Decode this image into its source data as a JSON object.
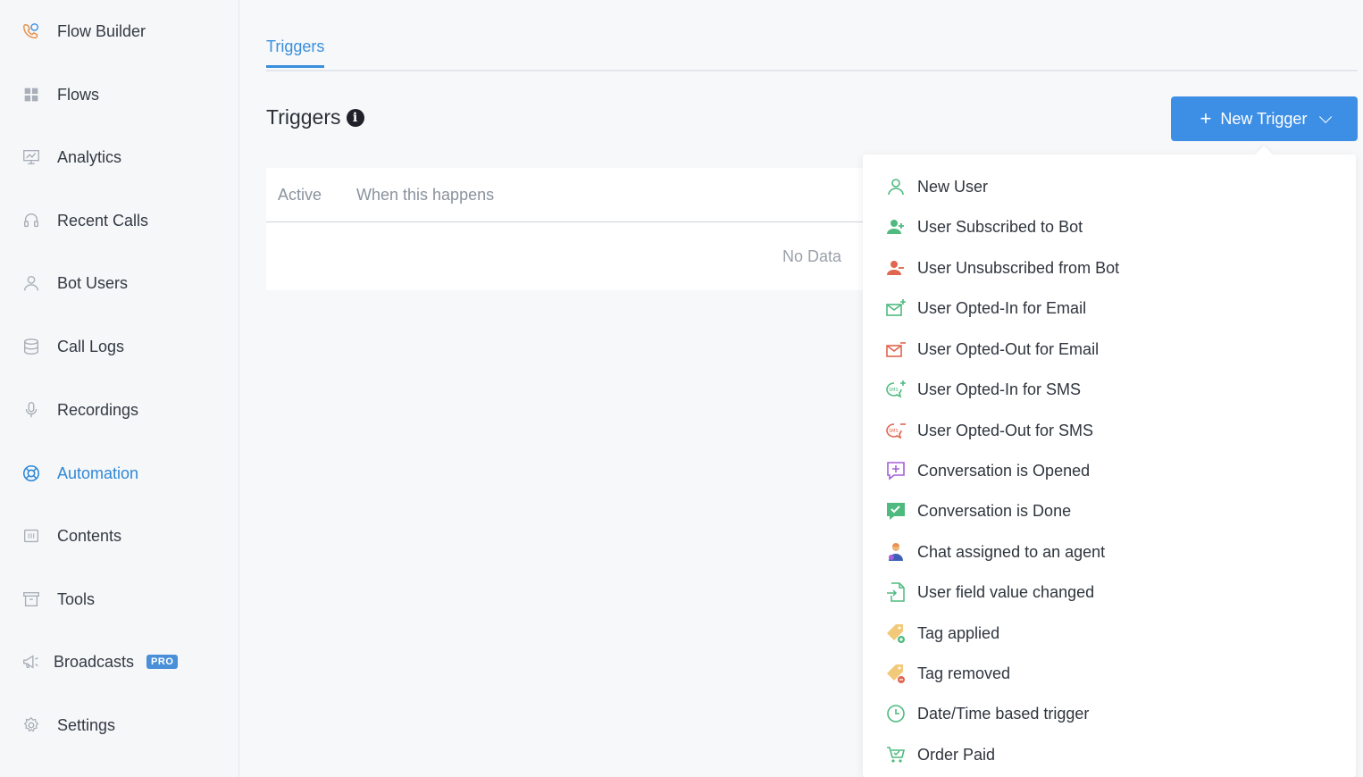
{
  "sidebar": {
    "items": [
      {
        "label": "Flow Builder",
        "icon": "phone-flow-icon"
      },
      {
        "label": "Flows",
        "icon": "grid-icon"
      },
      {
        "label": "Analytics",
        "icon": "presentation-chart-icon"
      },
      {
        "label": "Recent Calls",
        "icon": "headset-icon"
      },
      {
        "label": "Bot Users",
        "icon": "user-icon"
      },
      {
        "label": "Call Logs",
        "icon": "database-icon"
      },
      {
        "label": "Recordings",
        "icon": "microphone-icon"
      },
      {
        "label": "Automation",
        "icon": "lifebuoy-icon",
        "active": true
      },
      {
        "label": "Contents",
        "icon": "content-icon"
      },
      {
        "label": "Tools",
        "icon": "archive-box-icon"
      },
      {
        "label": "Broadcasts",
        "icon": "megaphone-icon",
        "badge": "PRO"
      },
      {
        "label": "Settings",
        "icon": "gear-icon"
      }
    ]
  },
  "tabs": [
    {
      "label": "Triggers",
      "active": true
    }
  ],
  "main": {
    "title": "Triggers",
    "info_glyph": "i",
    "new_trigger_label": "New Trigger",
    "table": {
      "columns": [
        "Active",
        "When this happens"
      ],
      "empty_text": "No Data"
    }
  },
  "dropdown": {
    "items": [
      {
        "label": "New User",
        "icon": "user-outline-icon"
      },
      {
        "label": "User Subscribed to Bot",
        "icon": "user-plus-icon"
      },
      {
        "label": "User Unsubscribed from Bot",
        "icon": "user-minus-icon"
      },
      {
        "label": "User Opted-In for Email",
        "icon": "email-plus-icon"
      },
      {
        "label": "User Opted-Out for Email",
        "icon": "email-minus-icon"
      },
      {
        "label": "User Opted-In for SMS",
        "icon": "sms-plus-icon"
      },
      {
        "label": "User Opted-Out for SMS",
        "icon": "sms-minus-icon"
      },
      {
        "label": "Conversation is Opened",
        "icon": "chat-plus-icon"
      },
      {
        "label": "Conversation is Done",
        "icon": "chat-check-icon"
      },
      {
        "label": "Chat assigned to an agent",
        "icon": "agent-icon"
      },
      {
        "label": "User field value changed",
        "icon": "file-import-icon"
      },
      {
        "label": "Tag applied",
        "icon": "tag-plus-icon"
      },
      {
        "label": "Tag removed",
        "icon": "tag-minus-icon"
      },
      {
        "label": "Date/Time based trigger",
        "icon": "clock-icon"
      },
      {
        "label": "Order Paid",
        "icon": "cart-icon"
      }
    ]
  },
  "colors": {
    "accent": "#3d8fe6",
    "active_nav": "#2f88d6",
    "green": "#4fba7f",
    "red": "#e0664f",
    "purple": "#a55fd8"
  }
}
